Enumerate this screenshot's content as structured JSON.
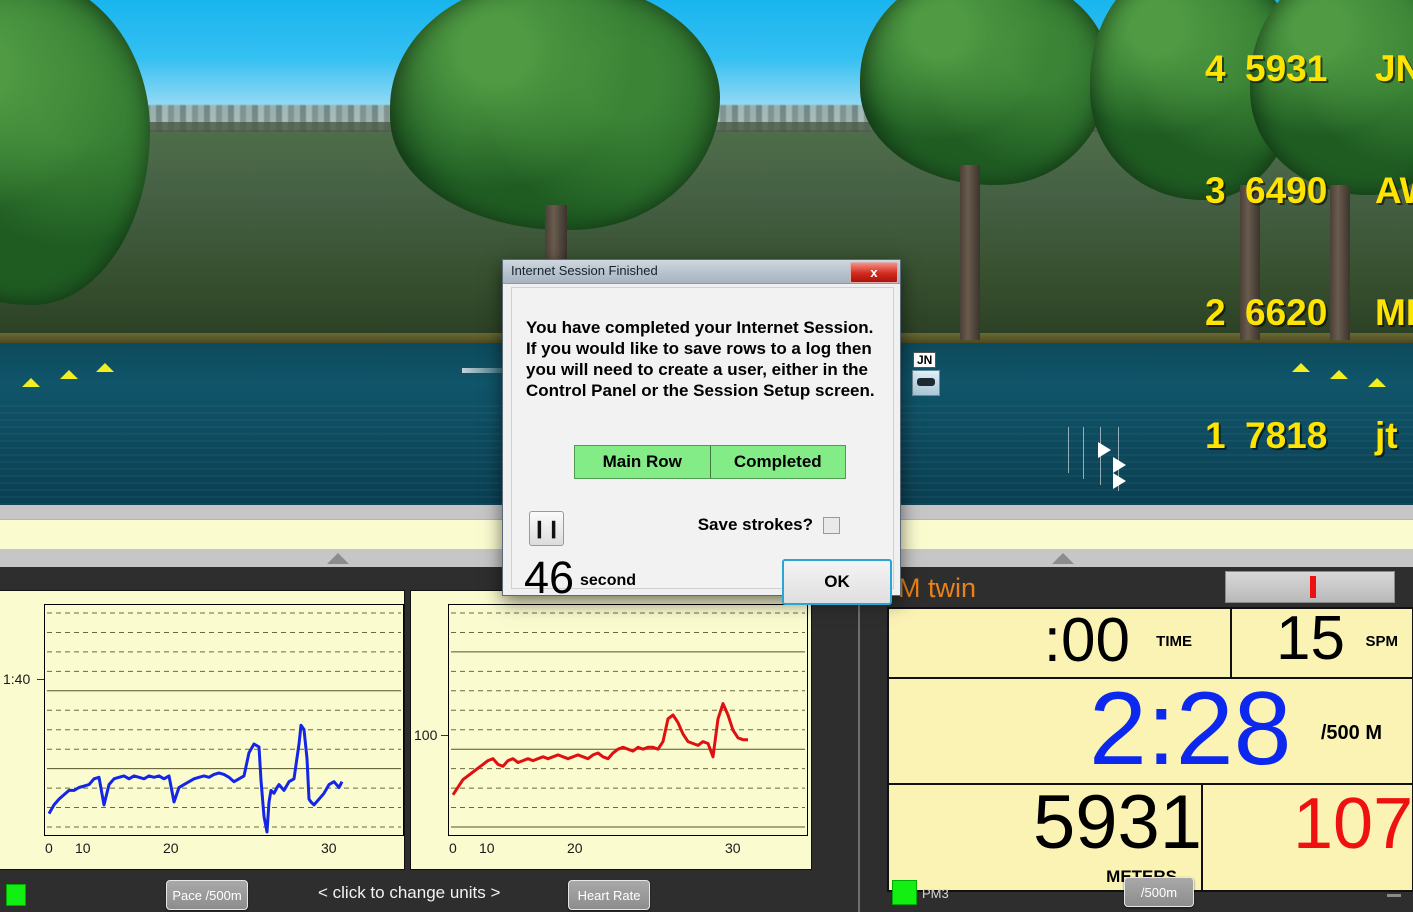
{
  "scene": {
    "leaderboard": [
      {
        "rank": "4",
        "distance": "5931",
        "name": "JN"
      },
      {
        "rank": "3",
        "distance": "6490",
        "name": "AW"
      },
      {
        "rank": "2",
        "distance": "6620",
        "name": "MK"
      },
      {
        "rank": "1",
        "distance": "7818",
        "name": "jt"
      }
    ],
    "boat_tag": "JN"
  },
  "dialog": {
    "title": "Internet Session Finished",
    "close_label": "x",
    "message": "You have completed your Internet Session.  If you would like to save rows to a log then you will need to create a user, either in the Control Panel or the Session Setup screen.",
    "status_left": "Main Row",
    "status_right": "Completed",
    "save_strokes_label": "Save strokes?",
    "pause_glyph": "❙❙",
    "countdown_value": "46",
    "countdown_unit": "second",
    "ok_label": "OK"
  },
  "toolbar": {
    "pace_button": "Pace /500m",
    "change_units": "<  click to change units  >",
    "heart_rate_button": "Heart Rate"
  },
  "monitor": {
    "title": "M twin",
    "time_value": ":00",
    "time_unit": "TIME",
    "spm_value": "15",
    "spm_unit": "SPM",
    "pace_value": "2:28",
    "pace_unit": "/500 M",
    "meters_value": "5931",
    "meters_unit": "METERS",
    "hr_value": "107",
    "device_label": "PM3",
    "units_button": "/500m"
  },
  "chart_data": [
    {
      "type": "line",
      "title": "Pace /500m",
      "xlabel": "",
      "ylabel": "Pace /500m",
      "xticks": [
        "0",
        "10",
        "20",
        "30"
      ],
      "yticks": [
        "1:40"
      ],
      "color": "#1326e8",
      "xlim": [
        0,
        35
      ],
      "x": [
        0,
        0.5,
        1,
        1.5,
        2,
        2.5,
        3,
        3.5,
        4,
        4.5,
        5,
        5.5,
        6,
        6.5,
        7,
        7.5,
        8,
        8.5,
        9,
        9.5,
        10,
        10.5,
        11,
        11.5,
        12,
        12.5,
        13,
        13.5,
        14,
        14.5,
        15,
        15.5,
        16,
        16.5,
        17,
        17.5,
        18,
        18.5,
        19,
        19.5,
        20,
        20.5,
        21,
        21.2,
        21.5,
        21.8,
        22,
        22.2,
        22.5,
        22.8,
        23,
        23.5,
        24,
        24.5,
        25,
        25.2,
        25.5,
        25.8,
        26,
        26.2,
        26.5,
        27,
        27.5,
        28,
        28.5,
        29,
        29.3
      ],
      "values": [
        -28,
        -22,
        -18,
        -15,
        -12,
        -12,
        -10,
        -9,
        -8,
        -4,
        -3,
        -22,
        -8,
        -4,
        -3,
        -2,
        -4,
        -2,
        -3,
        -4,
        -2,
        -3,
        -2,
        -4,
        -2,
        -20,
        -10,
        -8,
        -6,
        -4,
        -3,
        -2,
        -3,
        -1,
        0,
        -1,
        -3,
        -6,
        -4,
        -2,
        14,
        20,
        18,
        -5,
        -30,
        -48,
        -20,
        -12,
        -14,
        -10,
        -8,
        -12,
        -6,
        -4,
        20,
        33,
        30,
        10,
        -18,
        -20,
        -22,
        -18,
        -14,
        -8,
        -6,
        -10,
        -6
      ],
      "grid": true
    },
    {
      "type": "line",
      "title": "Heart Rate",
      "xlabel": "",
      "ylabel": "Heart Rate",
      "xticks": [
        "0",
        "10",
        "20",
        "30"
      ],
      "yticks": [
        "100"
      ],
      "color": "#e01010",
      "xlim": [
        0,
        35
      ],
      "x": [
        0,
        0.5,
        1,
        1.5,
        2,
        2.5,
        3,
        3.5,
        4,
        4.5,
        5,
        5.5,
        6,
        6.5,
        7,
        7.5,
        8,
        8.5,
        9,
        9.5,
        10,
        10.5,
        11,
        11.5,
        12,
        12.5,
        13,
        13.5,
        14,
        14.5,
        15,
        15.5,
        16,
        16.5,
        17,
        17.5,
        18,
        18.5,
        19,
        19.5,
        20,
        20.5,
        21,
        21.5,
        22,
        22.5,
        23,
        23.5,
        24,
        24.5,
        25,
        25.5,
        26,
        26.5,
        27,
        27.5,
        28,
        28.5,
        29,
        29.5
      ],
      "values": [
        78,
        82,
        86,
        88,
        90,
        92,
        94,
        96,
        97,
        94,
        93,
        96,
        97,
        95,
        96,
        97,
        96,
        97,
        98,
        97,
        98,
        99,
        98,
        97,
        98,
        99,
        98,
        97,
        99,
        100,
        98,
        97,
        100,
        102,
        103,
        102,
        101,
        103,
        102,
        103,
        103,
        102,
        106,
        118,
        120,
        116,
        110,
        106,
        105,
        104,
        106,
        105,
        98,
        118,
        126,
        120,
        112,
        108,
        107,
        107
      ],
      "grid": true
    }
  ]
}
